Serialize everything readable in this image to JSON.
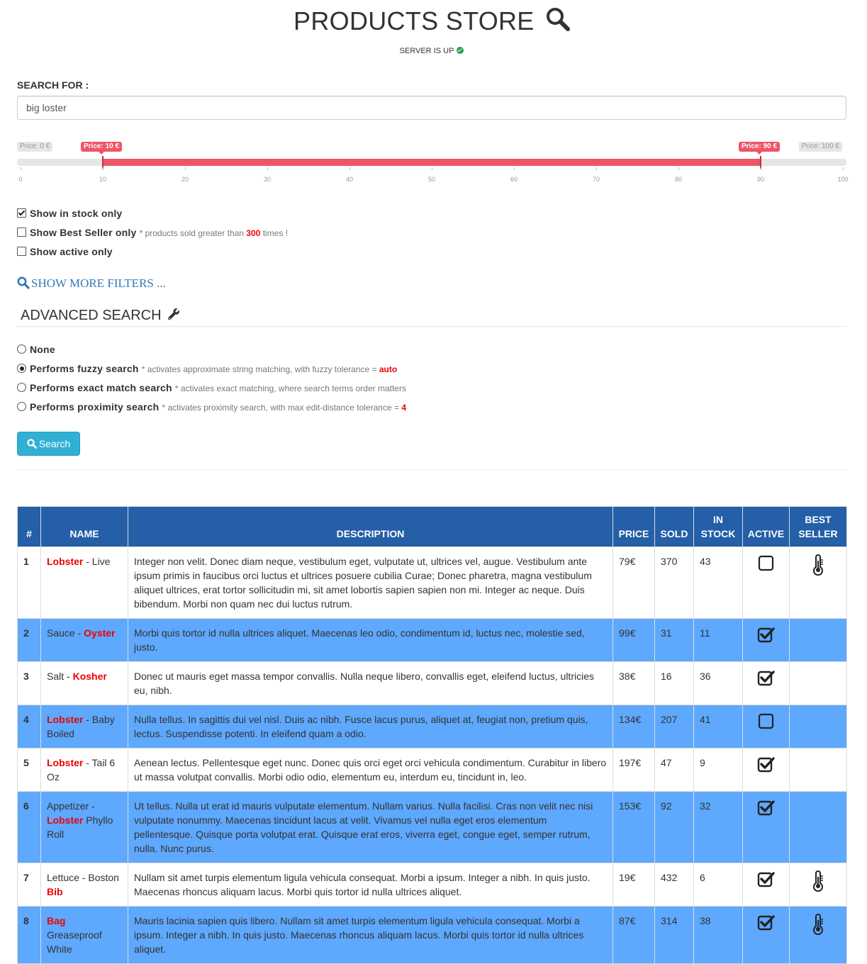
{
  "header": {
    "title": "PRODUCTS STORE",
    "server_status": "SERVER IS UP"
  },
  "search": {
    "label": "SEARCH FOR :",
    "value": "big loster"
  },
  "slider": {
    "min_label": "Price: 0 €",
    "low_label": "Price: 10 €",
    "high_label": "Price: 90 €",
    "max_label": "Price: 100 €",
    "min": 0,
    "max": 100,
    "low": 10,
    "high": 90,
    "ticks": [
      "0",
      "10",
      "20",
      "30",
      "40",
      "50",
      "60",
      "70",
      "80",
      "90",
      "100"
    ],
    "accent_color": "#ef5566"
  },
  "filters": {
    "in_stock": {
      "label": "Show in stock only",
      "checked": true
    },
    "best_seller": {
      "label": "Show Best Seller only",
      "note_pre": "* products sold greater than",
      "note_value": "300",
      "note_post": "times !",
      "checked": false
    },
    "active": {
      "label": "Show active only",
      "checked": false
    },
    "more_filters": "SHOW MORE FILTERS ..."
  },
  "advanced": {
    "title": "ADVANCED SEARCH",
    "options": [
      {
        "label": "None",
        "note": "",
        "value": "",
        "selected": false
      },
      {
        "label": "Performs fuzzy search",
        "note": "* activates approximate string matching, with fuzzy tolerance =",
        "value": "auto",
        "selected": true
      },
      {
        "label": "Performs exact match search",
        "note": "* activates exact matching, where search terms order matters",
        "value": "",
        "selected": false
      },
      {
        "label": "Performs proximity search",
        "note": "* activates proximity search, with max edit-distance tolerance =",
        "value": "4",
        "selected": false
      }
    ],
    "search_button": "Search"
  },
  "table": {
    "headers": {
      "num": "#",
      "name": "NAME",
      "description": "DESCRIPTION",
      "price": "PRICE",
      "sold": "SOLD",
      "in_stock_1": "IN",
      "in_stock_2": "STOCK",
      "active": "ACTIVE",
      "best_1": "BEST",
      "best_2": "SELLER"
    },
    "header_color": "#245fa8",
    "highlight_color": "#5ea8fd",
    "rows": [
      {
        "num": "1",
        "name_a": "Lobster",
        "name_b": " - Live",
        "name_a_red": true,
        "name_b_red": false,
        "description": "Integer non velit. Donec diam neque, vestibulum eget, vulputate ut, ultrices vel, augue. Vestibulum ante ipsum primis in faucibus orci luctus et ultrices posuere cubilia Curae; Donec pharetra, magna vestibulum aliquet ultrices, erat tortor sollicitudin mi, sit amet lobortis sapien sapien non mi. Integer ac neque. Duis bibendum. Morbi non quam nec dui luctus rutrum.",
        "price": "79€",
        "sold": "370",
        "in_stock": "43",
        "active": false,
        "best_seller": true,
        "highlight": false
      },
      {
        "num": "2",
        "name_a": "Sauce - ",
        "name_b": "Oyster",
        "name_a_red": false,
        "name_b_red": true,
        "description": "Morbi quis tortor id nulla ultrices aliquet. Maecenas leo odio, condimentum id, luctus nec, molestie sed, justo.",
        "price": "99€",
        "sold": "31",
        "in_stock": "11",
        "active": true,
        "best_seller": false,
        "highlight": true
      },
      {
        "num": "3",
        "name_a": "Salt - ",
        "name_b": "Kosher",
        "name_a_red": false,
        "name_b_red": true,
        "description": "Donec ut mauris eget massa tempor convallis. Nulla neque libero, convallis eget, eleifend luctus, ultricies eu, nibh.",
        "price": "38€",
        "sold": "16",
        "in_stock": "36",
        "active": true,
        "best_seller": false,
        "highlight": false
      },
      {
        "num": "4",
        "name_a": "Lobster",
        "name_b": " - Baby Boiled",
        "name_a_red": true,
        "name_b_red": false,
        "description": "Nulla tellus. In sagittis dui vel nisl. Duis ac nibh. Fusce lacus purus, aliquet at, feugiat non, pretium quis, lectus. Suspendisse potenti. In eleifend quam a odio.",
        "price": "134€",
        "sold": "207",
        "in_stock": "41",
        "active": false,
        "best_seller": false,
        "highlight": true
      },
      {
        "num": "5",
        "name_a": "Lobster",
        "name_b": " - Tail 6 Oz",
        "name_a_red": true,
        "name_b_red": false,
        "description": "Aenean lectus. Pellentesque eget nunc. Donec quis orci eget orci vehicula condimentum. Curabitur in libero ut massa volutpat convallis. Morbi odio odio, elementum eu, interdum eu, tincidunt in, leo.",
        "price": "197€",
        "sold": "47",
        "in_stock": "9",
        "active": true,
        "best_seller": false,
        "highlight": false
      },
      {
        "num": "6",
        "name_pre": "Appetizer - ",
        "name_a": "Lobster",
        "name_b": " Phyllo Roll",
        "name_a_red": true,
        "name_b_red": false,
        "description": "Ut tellus. Nulla ut erat id mauris vulputate elementum. Nullam varius. Nulla facilisi. Cras non velit nec nisi vulputate nonummy. Maecenas tincidunt lacus at velit. Vivamus vel nulla eget eros elementum pellentesque. Quisque porta volutpat erat. Quisque erat eros, viverra eget, congue eget, semper rutrum, nulla. Nunc purus.",
        "price": "153€",
        "sold": "92",
        "in_stock": "32",
        "active": true,
        "best_seller": false,
        "highlight": true
      },
      {
        "num": "7",
        "name_a": "Lettuce - Boston ",
        "name_b": "Bib",
        "name_a_red": false,
        "name_b_red": true,
        "description": "Nullam sit amet turpis elementum ligula vehicula consequat. Morbi a ipsum. Integer a nibh. In quis justo. Maecenas rhoncus aliquam lacus. Morbi quis tortor id nulla ultrices aliquet.",
        "price": "19€",
        "sold": "432",
        "in_stock": "6",
        "active": true,
        "best_seller": true,
        "highlight": false
      },
      {
        "num": "8",
        "name_a": "Bag",
        "name_b": " Greaseproof White",
        "name_a_red": true,
        "name_b_red": false,
        "description": "Mauris lacinia sapien quis libero. Nullam sit amet turpis elementum ligula vehicula consequat. Morbi a ipsum. Integer a nibh. In quis justo. Maecenas rhoncus aliquam lacus. Morbi quis tortor id nulla ultrices aliquet.",
        "price": "87€",
        "sold": "314",
        "in_stock": "38",
        "active": true,
        "best_seller": true,
        "highlight": true
      }
    ]
  }
}
